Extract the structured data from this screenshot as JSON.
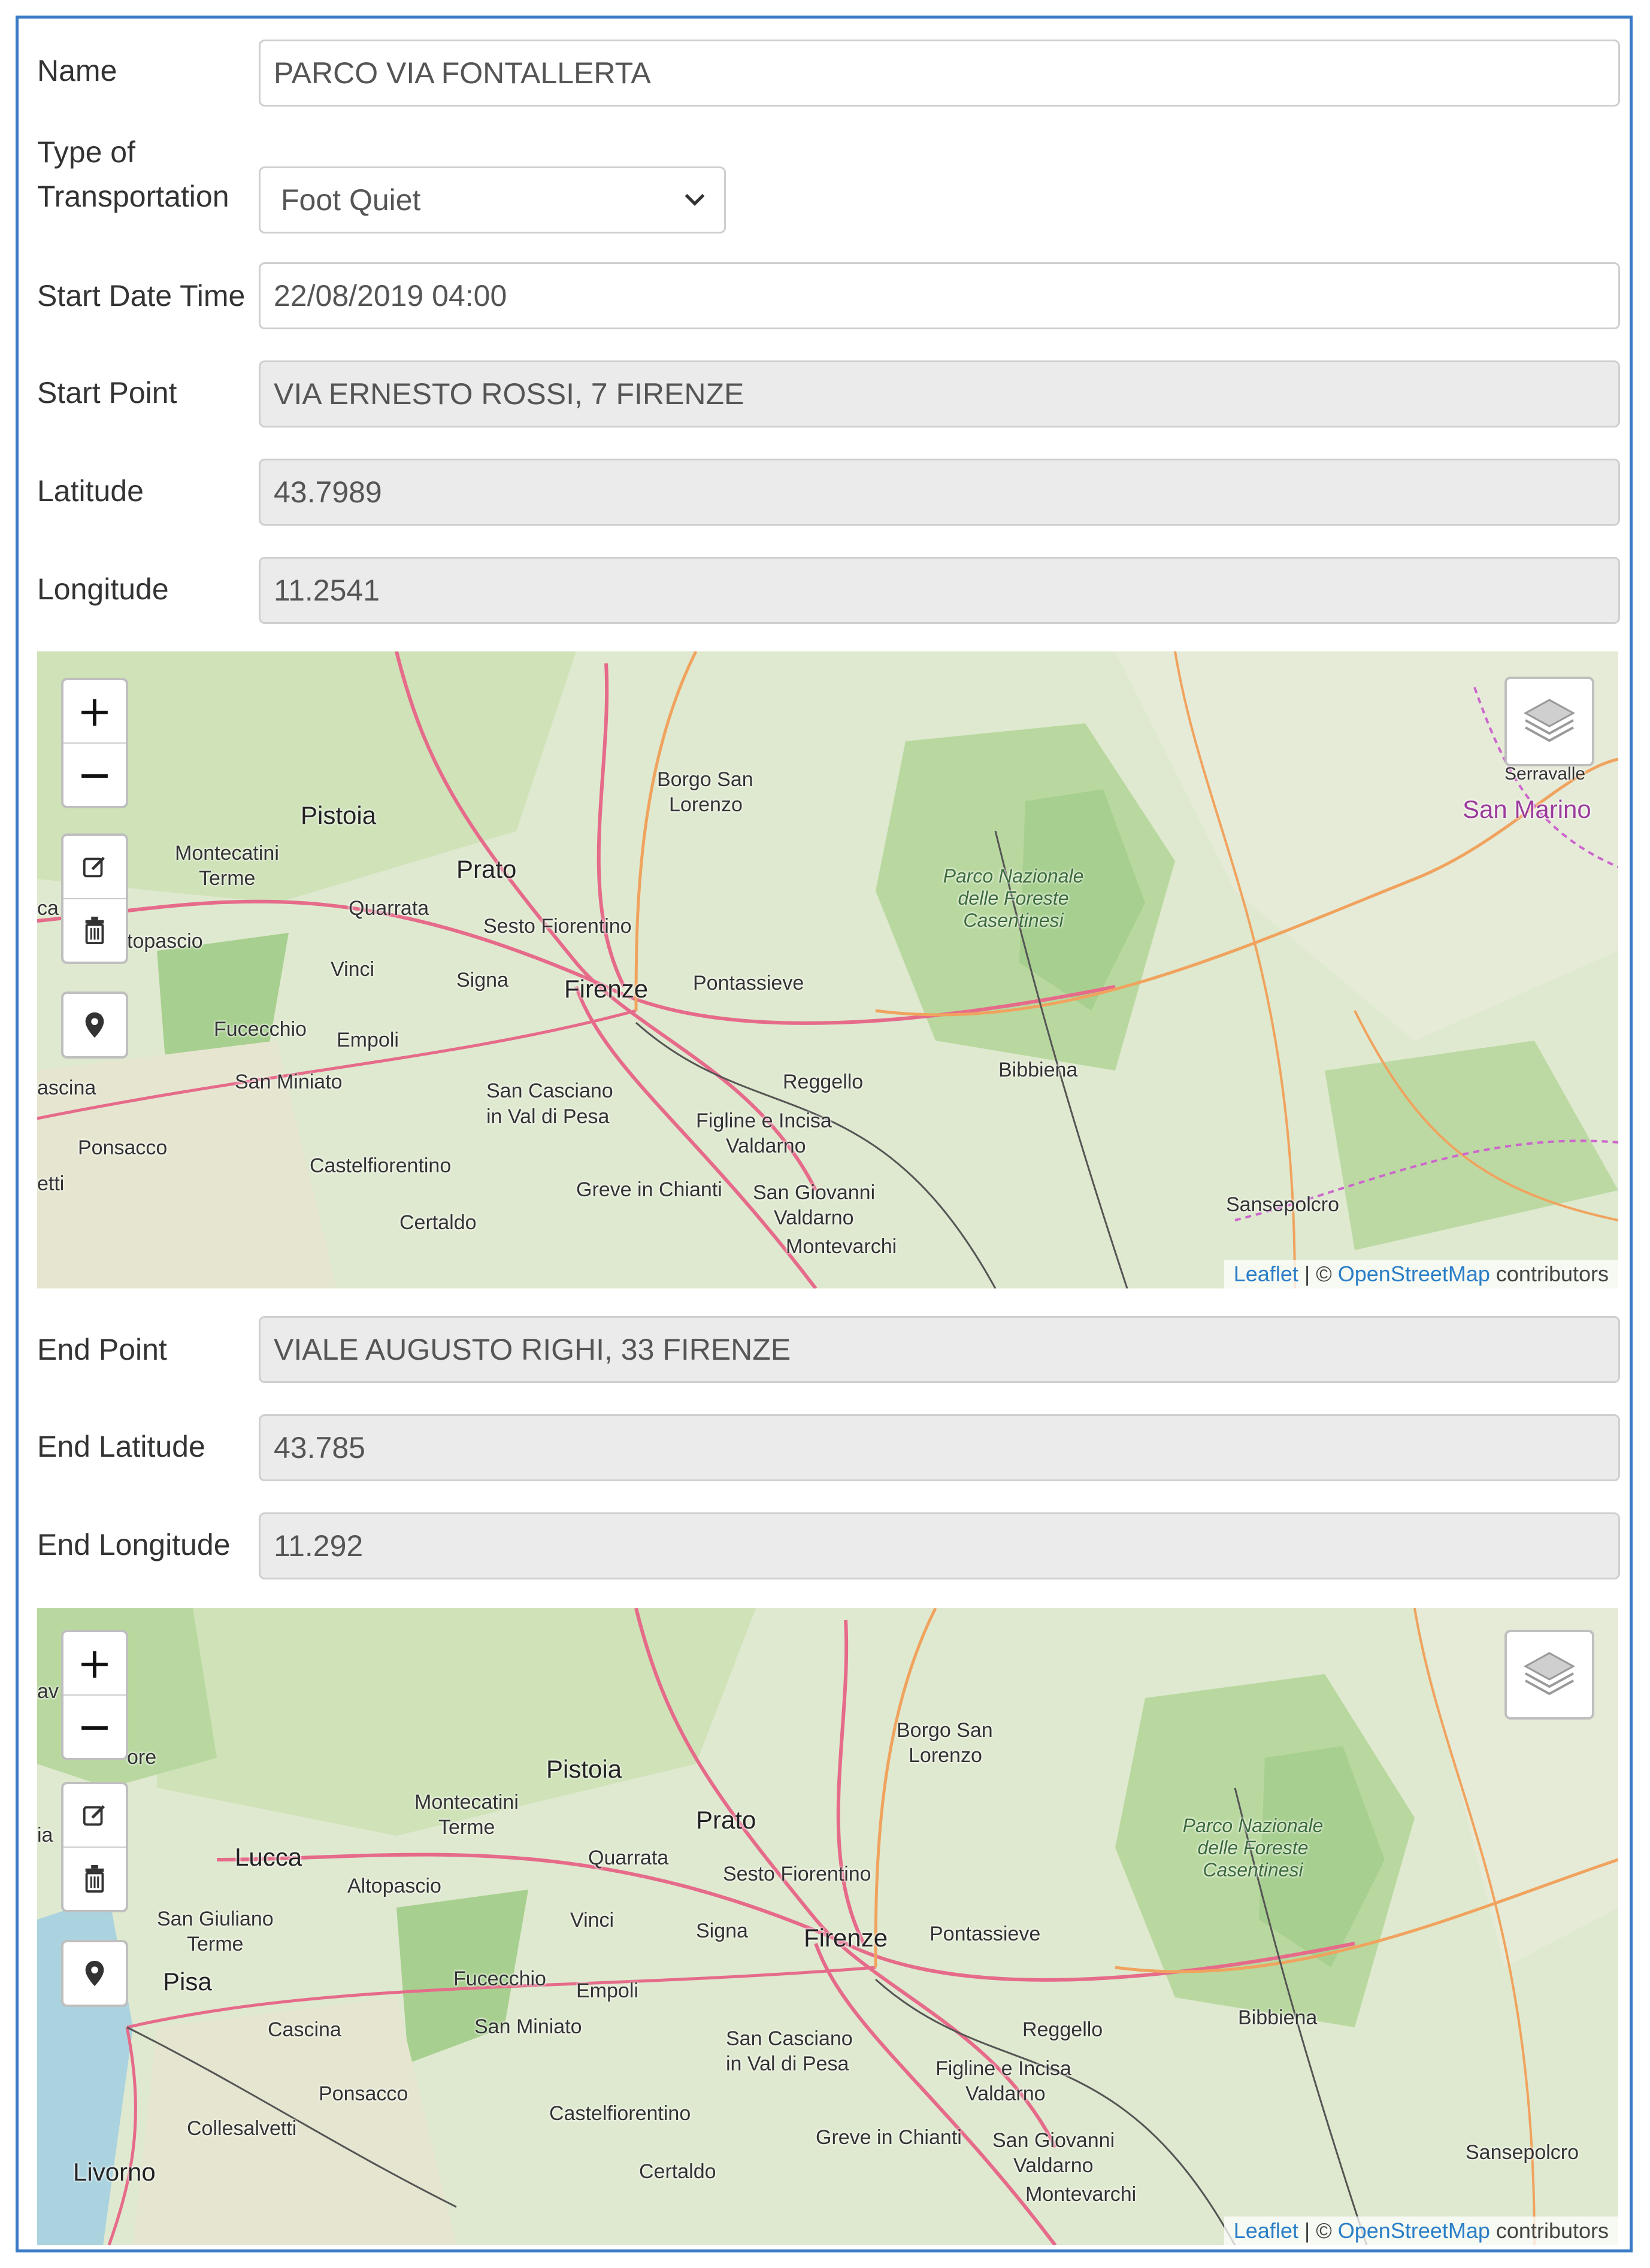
{
  "form": {
    "name": {
      "label": "Name",
      "value": "PARCO VIA FONTALLERTA"
    },
    "transport": {
      "label_line1": "Type of",
      "label_line2": "Transportation",
      "value": "Foot Quiet"
    },
    "start_date": {
      "label": "Start Date Time",
      "value": "22/08/2019 04:00"
    },
    "start_point": {
      "label": "Start Point",
      "value": "VIA ERNESTO ROSSI, 7 FIRENZE"
    },
    "latitude": {
      "label": "Latitude",
      "value": "43.7989"
    },
    "longitude": {
      "label": "Longitude",
      "value": "11.2541"
    },
    "end_point": {
      "label": "End Point",
      "value": "VIALE AUGUSTO RIGHI, 33 FIRENZE"
    },
    "end_latitude": {
      "label": "End Latitude",
      "value": "43.785"
    },
    "end_longitude": {
      "label": "End Longitude",
      "value": "11.292"
    }
  },
  "map_controls": {
    "zoom_in": "+",
    "zoom_out": "−",
    "edit_icon": "edit-icon",
    "delete_icon": "trash-icon",
    "marker_icon": "map-marker-icon",
    "layers_icon": "layers-icon"
  },
  "attribution": {
    "leaflet": "Leaflet",
    "sep": " | © ",
    "osm": "OpenStreetMap",
    "tail": " contributors"
  },
  "map1_places": {
    "pistoia": "Pistoia",
    "montecatini": "Montecatini",
    "terme": "Terme",
    "prato": "Prato",
    "quarrata": "Quarrata",
    "sesto": "Sesto Fiorentino",
    "borgo1": "Borgo San",
    "borgo2": "Lorenzo",
    "vinci": "Vinci",
    "signa": "Signa",
    "firenze": "Firenze",
    "pontassieve": "Pontassieve",
    "fucecchio": "Fucecchio",
    "empoli": "Empoli",
    "sanminiato": "San Miniato",
    "sancasciano1": "San Casciano",
    "sancasciano2": "in Val di Pesa",
    "reggello": "Reggello",
    "figline1": "Figline e Incisa",
    "figline2": "Valdarno",
    "ponsacco": "Ponsacco",
    "castelfiorentino": "Castelfiorentino",
    "greve": "Greve in Chianti",
    "sangiovanni1": "San Giovanni",
    "sangiovanni2": "Valdarno",
    "montevarchi": "Montevarchi",
    "certaldo": "Certaldo",
    "bibbiena": "Bibbiena",
    "sansepolcro": "Sansepolcro",
    "parco1": "Parco Nazionale",
    "parco2": "delle Foreste",
    "parco3": "Casentinesi",
    "serravalle": "Serravalle",
    "sanmarino": "San Marino",
    "altopascio": "topascio",
    "cascina": "ascina",
    "tti": "etti",
    "ca": "ca"
  },
  "map2_places": {
    "pistoia": "Pistoia",
    "montecatini": "Montecatini",
    "terme": "Terme",
    "prato": "Prato",
    "lucca": "Lucca",
    "altopascio": "Altopascio",
    "quarrata": "Quarrata",
    "sesto": "Sesto Fiorentino",
    "borgo1": "Borgo San",
    "borgo2": "Lorenzo",
    "vinci": "Vinci",
    "signa": "Signa",
    "firenze": "Firenze",
    "pontassieve": "Pontassieve",
    "sangiuliano1": "San Giuliano",
    "sangiuliano2": "Terme",
    "pisa": "Pisa",
    "fucecchio": "Fucecchio",
    "empoli": "Empoli",
    "cascina": "Cascina",
    "sanminiato": "San Miniato",
    "sancasciano1": "San Casciano",
    "sancasciano2": "in Val di Pesa",
    "reggello": "Reggello",
    "figline1": "Figline e Incisa",
    "figline2": "Valdarno",
    "ponsacco": "Ponsacco",
    "castelfiorentino": "Castelfiorentino",
    "collesalvetti": "Collesalvetti",
    "greve": "Greve in Chianti",
    "sangiovanni1": "San Giovanni",
    "sangiovanni2": "Valdarno",
    "montevarchi": "Montevarchi",
    "livorno": "Livorno",
    "certaldo": "Certaldo",
    "bibbiena": "Bibbiena",
    "sansepolcro": "Sansepolcro",
    "parco1": "Parco Nazionale",
    "parco2": "delle Foreste",
    "parco3": "Casentinesi",
    "ore": "ore",
    "av": "av",
    "ia": "ia"
  }
}
